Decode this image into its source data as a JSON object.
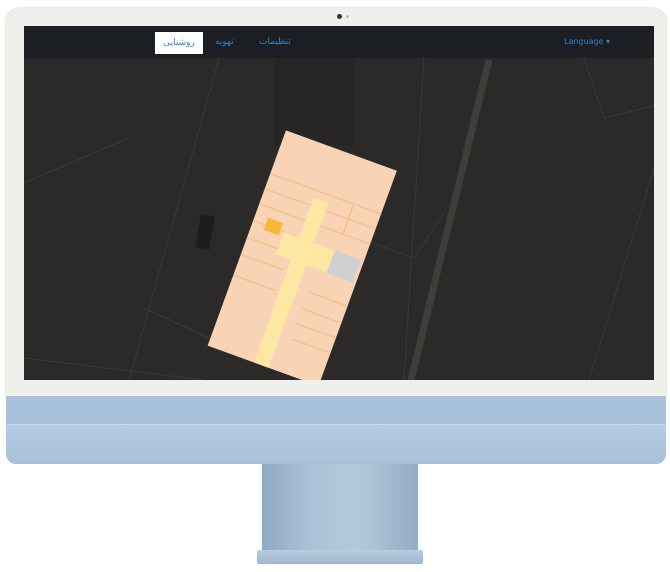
{
  "navbar": {
    "active_item": "روشنایی",
    "items": [
      "تهویه",
      "تنظیمات"
    ],
    "language_label": "Language ▾"
  },
  "colors": {
    "map_background": "#2b2a28",
    "navbar_background": "#1b1e22",
    "link_color": "#3b7ec8",
    "room_fill": "#f8d3b6",
    "corridor_fill": "#fde7a2",
    "highlight_room": "#f8b93a",
    "gray_room": "#cfd0d2",
    "monitor_body": "#a9c2dc"
  }
}
